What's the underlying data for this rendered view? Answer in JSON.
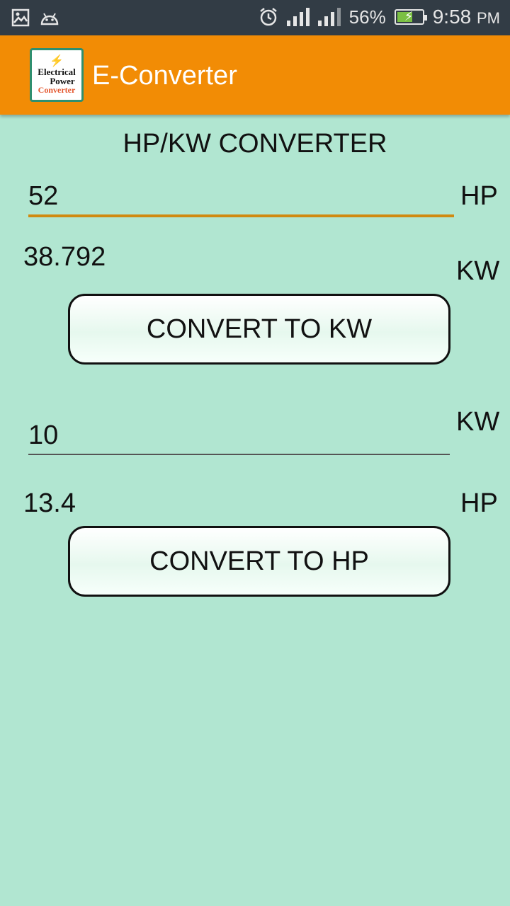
{
  "status_bar": {
    "battery_percent": "56%",
    "time": "9:58",
    "ampm": "PM",
    "icons": [
      "image-icon",
      "android-icon",
      "alarm-icon",
      "signal-icon",
      "signal-icon",
      "battery-charging-icon"
    ]
  },
  "app_bar": {
    "title": "E-Converter",
    "logo_lines": [
      "Electrical",
      "Power",
      "Converter"
    ],
    "color": "#f28c05"
  },
  "converter": {
    "title": "HP/KW CONVERTER",
    "hp_to_kw": {
      "input_value": "52",
      "input_unit": "HP",
      "result_value": "38.792",
      "result_unit": "KW",
      "button_label": "CONVERT TO KW"
    },
    "kw_to_hp": {
      "input_value": "10",
      "input_unit": "KW",
      "result_value": "13.4",
      "result_unit": "HP",
      "button_label": "CONVERT TO HP"
    }
  },
  "colors": {
    "background": "#b1e6d1",
    "status_bar": "#323c45",
    "active_underline": "#d08a10"
  }
}
